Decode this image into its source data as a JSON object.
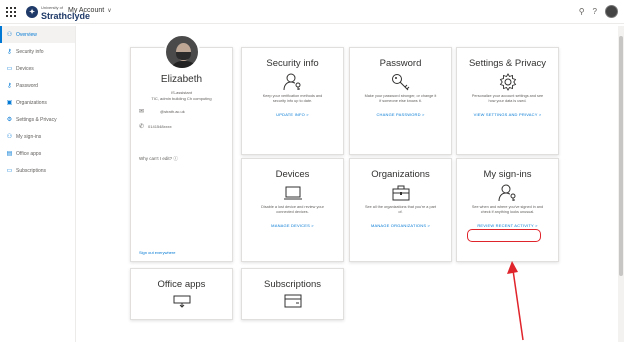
{
  "header": {
    "logo_text": "Strathclyde",
    "logo_subtext": "University of",
    "account_label": "My Account",
    "icons": [
      "waffle-icon",
      "lock-icon",
      "help-icon"
    ]
  },
  "sidebar": {
    "items": [
      {
        "label": "Overview",
        "icon": "person-icon",
        "active": true
      },
      {
        "label": "Security info",
        "icon": "key-icon"
      },
      {
        "label": "Devices",
        "icon": "laptop-icon"
      },
      {
        "label": "Password",
        "icon": "key-icon"
      },
      {
        "label": "Organizations",
        "icon": "briefcase-icon"
      },
      {
        "label": "Settings & Privacy",
        "icon": "gear-icon"
      },
      {
        "label": "My sign-ins",
        "icon": "person-key-icon"
      },
      {
        "label": "Office apps",
        "icon": "office-icon"
      },
      {
        "label": "Subscriptions",
        "icon": "card-icon"
      }
    ]
  },
  "profile": {
    "name": "Elizabeth",
    "line1": "IS-assistant",
    "line2": "TIC, admin building Ch computing",
    "email": "@strath.ac.uk",
    "phone": "0141548xxxx",
    "why_link": "Why can't I edit? ⓘ",
    "sign_out": "Sign out everywhere"
  },
  "cards": {
    "security_info": {
      "title": "Security info",
      "desc": "Keep your verification methods and security info up to date.",
      "link": "UPDATE INFO >"
    },
    "password": {
      "title": "Password",
      "desc": "Make your password stronger, or change it if someone else knows it.",
      "link": "CHANGE PASSWORD >"
    },
    "settings": {
      "title": "Settings & Privacy",
      "desc": "Personalize your account settings and see how your data is used.",
      "link": "VIEW SETTINGS AND PRIVACY >"
    },
    "devices": {
      "title": "Devices",
      "desc": "Disable a lost device and review your connected devices.",
      "link": "MANAGE DEVICES >"
    },
    "organizations": {
      "title": "Organizations",
      "desc": "See all the organizations that you're a part of.",
      "link": "MANAGE ORGANIZATIONS >"
    },
    "signins": {
      "title": "My sign-ins",
      "desc": "See when and where you've signed in and check if anything looks unusual.",
      "link": "REVIEW RECENT ACTIVITY >"
    },
    "office": {
      "title": "Office apps"
    },
    "subscriptions": {
      "title": "Subscriptions"
    }
  },
  "colors": {
    "accent": "#0078d4",
    "annotation": "#e0242b"
  }
}
